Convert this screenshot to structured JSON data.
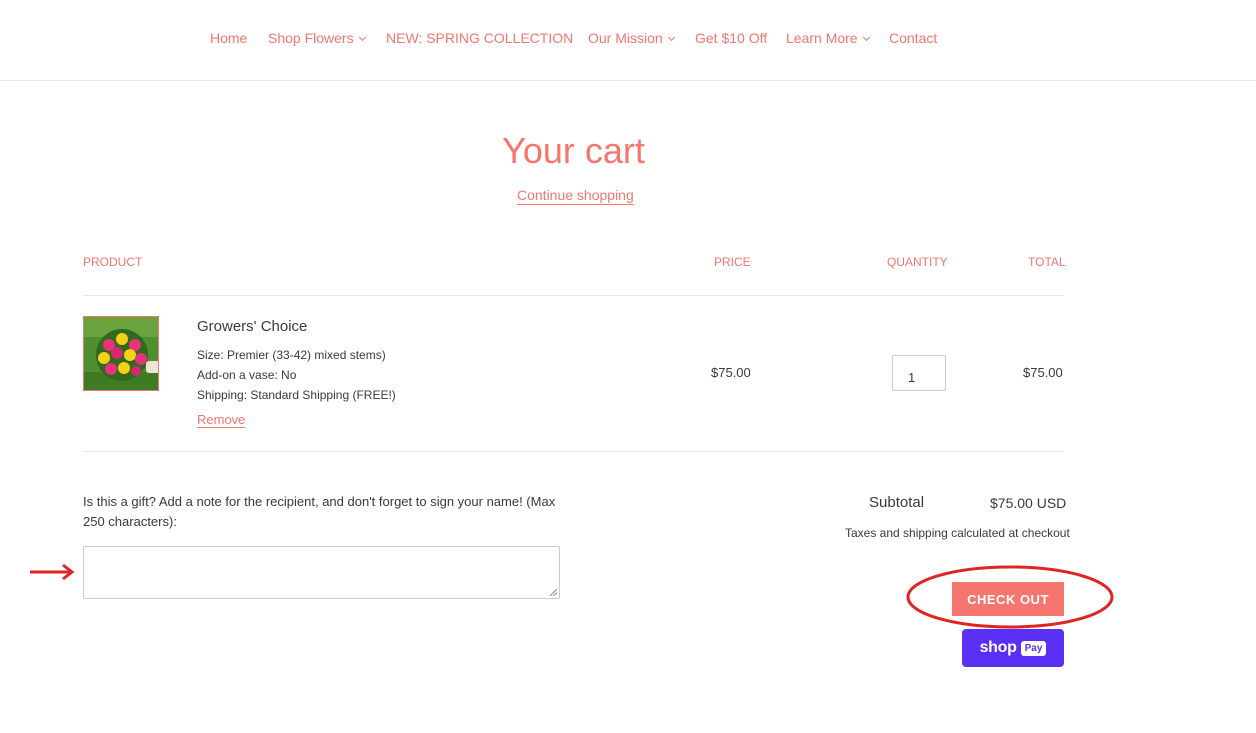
{
  "nav": {
    "items": [
      {
        "label": "Home",
        "dropdown": false
      },
      {
        "label": "Shop Flowers",
        "dropdown": true
      },
      {
        "label": "NEW: SPRING COLLECTION",
        "dropdown": false
      },
      {
        "label": "Our Mission",
        "dropdown": true
      },
      {
        "label": "Get $10 Off",
        "dropdown": false
      },
      {
        "label": "Learn More",
        "dropdown": true
      },
      {
        "label": "Contact",
        "dropdown": false
      }
    ]
  },
  "cart": {
    "title": "Your cart",
    "continue_label": "Continue shopping",
    "headers": {
      "product": "PRODUCT",
      "price": "PRICE",
      "quantity": "QUANTITY",
      "total": "TOTAL"
    },
    "item": {
      "name": "Growers' Choice",
      "options": [
        "Size: Premier (33-42) mixed stems)",
        "Add-on a vase: No",
        "Shipping: Standard Shipping (FREE!)"
      ],
      "remove_label": "Remove",
      "price": "$75.00",
      "quantity": "1",
      "total": "$75.00",
      "image_icon": "bouquet-image"
    },
    "note": {
      "label": "Is this a gift? Add a note for the recipient, and don't forget to sign your name! (Max 250 characters):",
      "value": ""
    },
    "subtotal_label": "Subtotal",
    "subtotal_value": "$75.00 USD",
    "tax_note": "Taxes and shipping calculated at checkout",
    "checkout_label": "CHECK OUT",
    "shoppay": {
      "word": "shop",
      "badge": "Pay"
    }
  },
  "colors": {
    "accent": "#f4766f",
    "annotation": "#e02424",
    "shoppay": "#5a31f4"
  }
}
